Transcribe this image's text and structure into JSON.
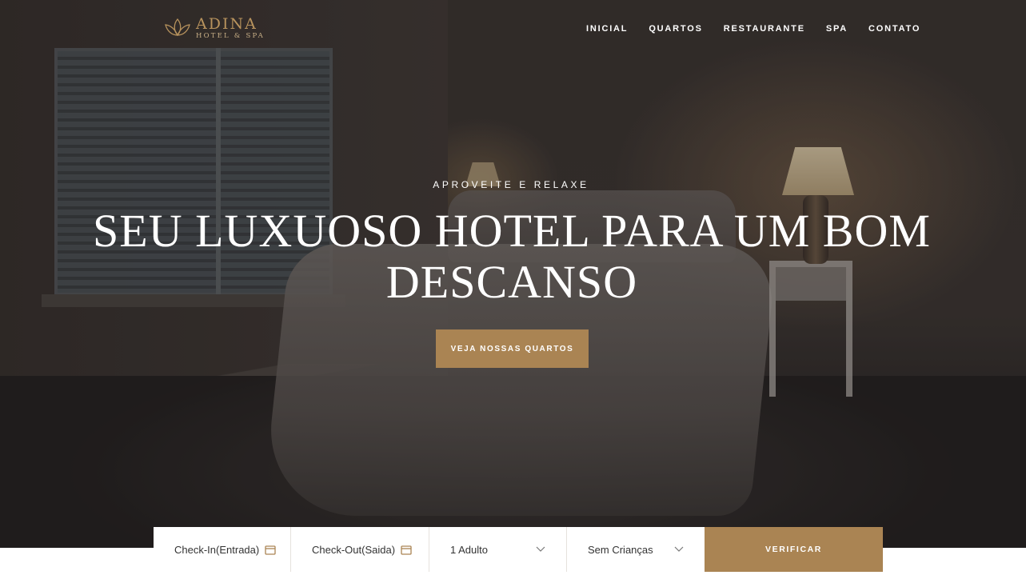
{
  "brand": {
    "name": "ADINA",
    "tagline": "HOTEL & SPA",
    "accent_color": "#aa8453",
    "logo_icon": "lotus-icon"
  },
  "nav": {
    "items": [
      {
        "label": "INICIAL"
      },
      {
        "label": "QUARTOS"
      },
      {
        "label": "RESTAURANTE"
      },
      {
        "label": "SPA"
      },
      {
        "label": "CONTATO"
      }
    ]
  },
  "hero": {
    "kicker": "APROVEITE E RELAXE",
    "headline": "SEU LUXUOSO HOTEL PARA UM BOM DESCANSO",
    "cta_label": "VEJA NOSSAS QUARTOS"
  },
  "booking": {
    "checkin_label": "Check-In(Entrada)",
    "checkin_icon": "calendar-icon",
    "checkout_label": "Check-Out(Saida)",
    "checkout_icon": "calendar-icon",
    "adults_value": "1 Adulto",
    "children_value": "Sem Crianças",
    "dropdown_icon": "chevron-down-icon",
    "submit_label": "VERIFICAR"
  }
}
